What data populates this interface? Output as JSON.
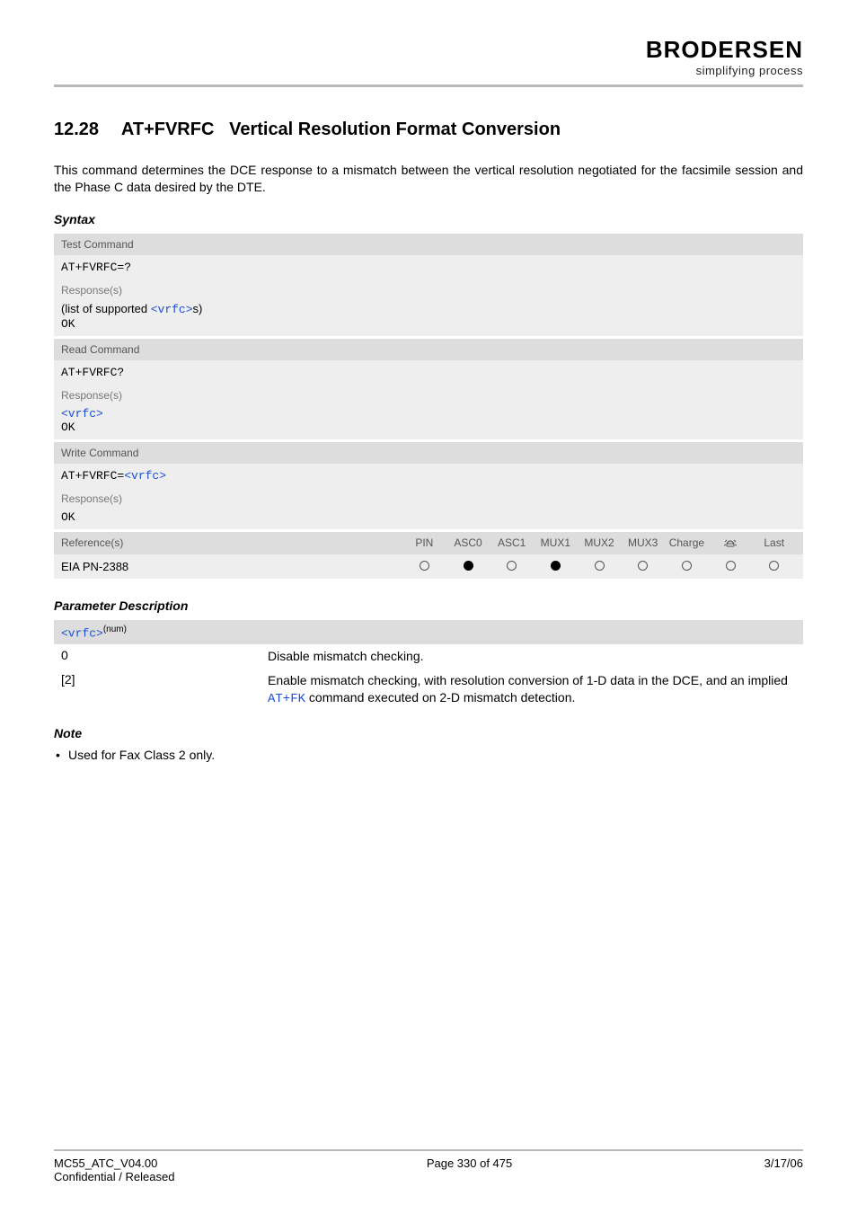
{
  "header": {
    "brand": "BRODERSEN",
    "tagline": "simplifying process"
  },
  "section": {
    "number": "12.28",
    "command": "AT+FVRFC",
    "title": "Vertical Resolution Format Conversion"
  },
  "intro": "This command determines the DCE response to a mismatch between the vertical resolution negotiated for the facsimile session and the Phase C data desired by the DTE.",
  "labels": {
    "syntax": "Syntax",
    "param_desc": "Parameter Description",
    "note": "Note",
    "test_cmd": "Test Command",
    "read_cmd": "Read Command",
    "write_cmd": "Write Command",
    "responses": "Response(s)",
    "references": "Reference(s)"
  },
  "syntax": {
    "test": {
      "cmd": "AT+FVRFC=?",
      "resp_prefix": "(list of supported ",
      "resp_param": "<vrfc>",
      "resp_suffix": "s)",
      "ok": "OK"
    },
    "read": {
      "cmd": "AT+FVRFC?",
      "resp_param": "<vrfc>",
      "ok": "OK"
    },
    "write": {
      "cmd_prefix": "AT+FVRFC=",
      "cmd_param": "<vrfc>",
      "ok": "OK"
    }
  },
  "reference": {
    "value": "EIA PN-2388",
    "cols": [
      "PIN",
      "ASC0",
      "ASC1",
      "MUX1",
      "MUX2",
      "MUX3",
      "Charge",
      "📞",
      "Last"
    ],
    "states": [
      "open",
      "filled",
      "open",
      "filled",
      "open",
      "open",
      "open",
      "open",
      "open"
    ]
  },
  "param": {
    "name": "<vrfc>",
    "sup": "(num)",
    "rows": [
      {
        "key": "0",
        "desc_plain": "Disable mismatch checking."
      },
      {
        "key": "[2]",
        "desc_before": "Enable mismatch checking, with resolution conversion of 1-D data in the DCE, and an implied ",
        "desc_link": "AT+FK",
        "desc_after": " command executed on 2-D mismatch detection."
      }
    ]
  },
  "notes": [
    "Used for Fax Class 2 only."
  ],
  "footer": {
    "left1": "MC55_ATC_V04.00",
    "left2": "Confidential / Released",
    "center": "Page 330 of 475",
    "right": "3/17/06"
  }
}
